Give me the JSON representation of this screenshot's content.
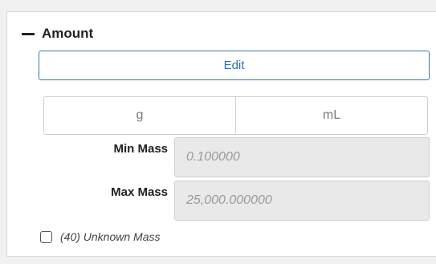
{
  "section": {
    "title": "Amount",
    "collapse_icon": "minus-icon"
  },
  "edit_button": {
    "label": "Edit"
  },
  "unit_toggle": {
    "options": [
      "g",
      "mL"
    ]
  },
  "fields": {
    "min_mass": {
      "label": "Min Mass",
      "value": "0.100000"
    },
    "max_mass": {
      "label": "Max Mass",
      "value": "25,000.000000"
    }
  },
  "unknown_mass": {
    "label": "(40) Unknown Mass",
    "checked": false
  },
  "colors": {
    "accent": "#2a6fb0",
    "input_disabled_bg": "#e9e9e9"
  }
}
